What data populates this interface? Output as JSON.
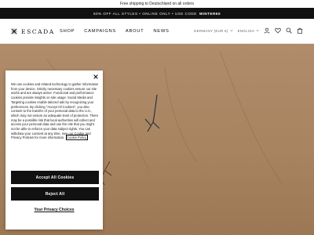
{
  "announcement": {
    "text": "Free shipping to Deutschland on all orders"
  },
  "promo": {
    "text": "60% OFF ALL STYLES • ONLINE ONLY • USE CODE",
    "code": "WINTER60"
  },
  "header": {
    "logo_text": "ESCADA",
    "nav": [
      "SHOP",
      "CAMPAIGNS",
      "ABOUT",
      "NEWS"
    ],
    "country": "GERMANY (EUR €)",
    "language": "ENGLISH",
    "icons": [
      "user-icon",
      "heart-icon",
      "search-icon",
      "bag-icon"
    ]
  },
  "cookie_modal": {
    "body": "We use cookies and related technology to gather information from your device. Strictly necessary cookies ensure our site works and are always active. Functional and performance cookies provide insights on site usage. Social Media and Targeting cookies enable tailored ads by recognizing your preferences. By clicking \"Accept All Cookies\", you also consent to the transfer of your personal data to the U.S., which may not ensure an adequate level of protection. There may be a possible risk that local authorities will collect and access your personal data and use the risk that you might not be able to enforce your data subject rights. You can withdraw your consent at any time. See our Cookie and Privacy Policies for more information.",
    "policy_link": "Cookie Policy",
    "accept_label": "Accept All Cookies",
    "reject_label": "Reject All",
    "choices_label": "Your Privacy Choices"
  },
  "colors": {
    "promo_bg": "#111111",
    "button_bg": "#111111",
    "hero_bg": "#b08a68"
  }
}
